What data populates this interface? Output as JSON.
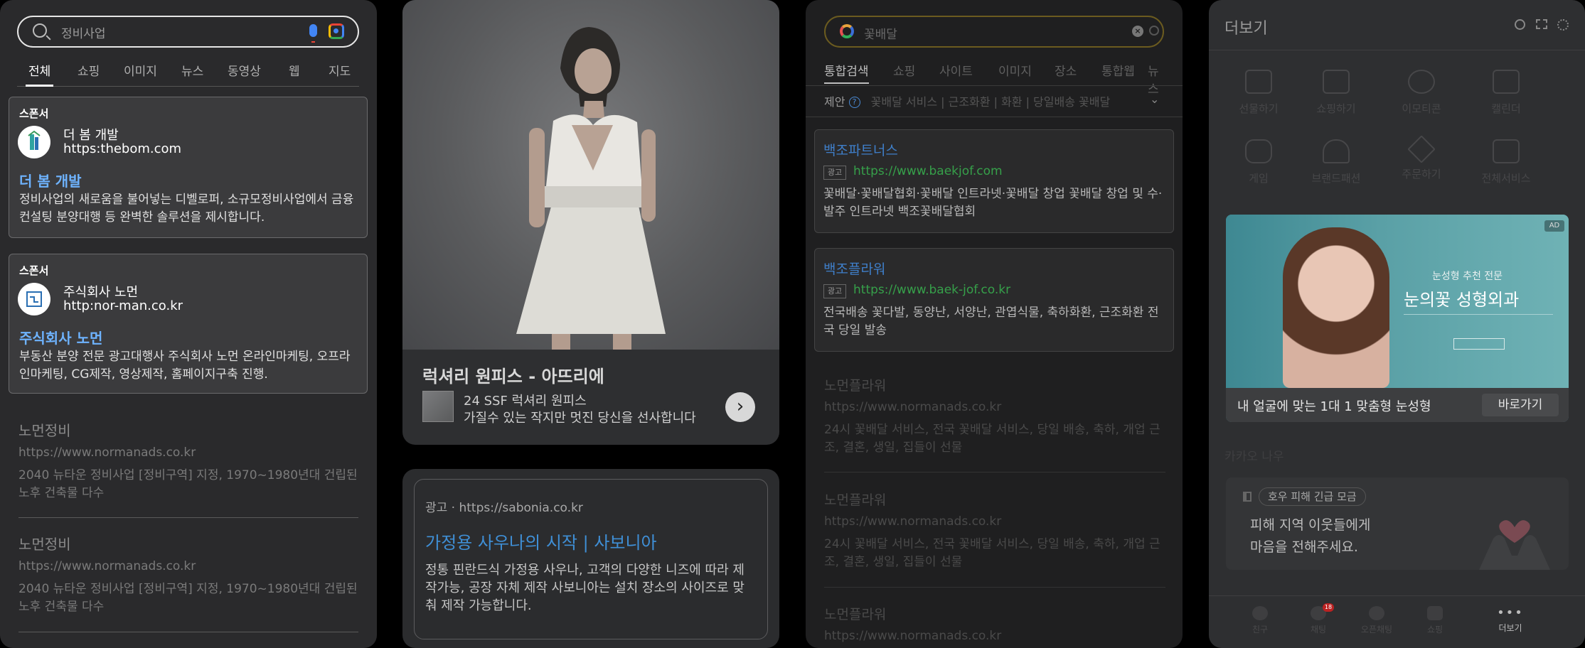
{
  "google": {
    "query": "정비사업",
    "tabs": [
      "전체",
      "쇼핑",
      "이미지",
      "뉴스",
      "동영상",
      "웹",
      "지도"
    ],
    "ads": [
      {
        "sponsor": "스폰서",
        "name": "더 봄 개발",
        "url": "https:thebom.com",
        "title": "더 봄 개발",
        "desc": "정비사업의 새로움을 불어넣는 디벨로퍼, 소규모정비사업에서 금융컨설팅 분양대행 등 완벽한 솔루션을 제시합니다."
      },
      {
        "sponsor": "스폰서",
        "name": "주식회사 노먼",
        "url": "http:nor-man.co.kr",
        "title": "주식회사 노먼",
        "desc": "부동산 분양 전문 광고대행사 주식회사 노먼 온라인마케팅, 오프라인마케팅, CG제작, 영상제작, 홈페이지구축 진행."
      }
    ],
    "results": [
      {
        "title": "노먼정비",
        "url": "https://www.normanads.co.kr",
        "desc": "2040 뉴타운 정비사업 [정비구역] 지정, 1970~1980년대 건립된 노후 건축물 다수"
      },
      {
        "title": "노먼정비",
        "url": "https://www.normanads.co.kr",
        "desc": "2040 뉴타운 정비사업 [정비구역] 지정, 1970~1980년대 건립된 노후 건축물 다수"
      }
    ]
  },
  "fashion_ad": {
    "title": "럭셔리 원피스 - 아뜨리에",
    "line1": "24 SSF 럭셔리 원피스",
    "line2": "가질수 있는 작지만 멋진 당신을 선사합니다",
    "arrow": "›"
  },
  "sauna_ad": {
    "meta": "광고 · https://sabonia.co.kr",
    "title": "가정용 사우나의 시작 | 사보니아",
    "desc": "정통 핀란드식 가정용 사우나, 고객의 다양한 니즈에 따라 제작가능, 공장 자체 제작 사보니아는 설치 장소의 사이즈로 맞춰 제작 가능합니다."
  },
  "daum": {
    "query": "꽃배달",
    "clear": "×",
    "tabs": [
      "통합검색",
      "쇼핑",
      "사이트",
      "이미지",
      "장소",
      "통합웹",
      "뉴스"
    ],
    "suggest_label": "제안",
    "suggest_q": "?",
    "suggestions": "꽃배달 서비스 | 근조화환 | 화환 | 당일배송 꽃배달",
    "ad_badge": "광고",
    "ads": [
      {
        "title": "백조파트너스",
        "url": "https://www.baekjof.com",
        "desc": "꽃배달·꽃배달협회·꽃배달 인트라넷·꽃배달 창업 꽃배달 창업 및 수·발주 인트라넷 백조꽃배달협회"
      },
      {
        "title": "백조플라워",
        "url": "https://www.baek-jof.co.kr",
        "desc": "전국배송 꽃다발, 동양난, 서양난, 관엽식물, 축하화환, 근조화환 전국 당일 발송"
      }
    ],
    "results": [
      {
        "title": "노먼플라워",
        "url": "https://www.normanads.co.kr",
        "desc": "24시 꽃배달 서비스, 전국 꽃배달 서비스, 당일 배송, 축하, 개업 근조, 결혼, 생일, 집들이 선물"
      },
      {
        "title": "노먼플라워",
        "url": "https://www.normanads.co.kr",
        "desc": "24시 꽃배달 서비스, 전국 꽃배달 서비스, 당일 배송, 축하, 개업 근조, 결혼, 생일, 집들이 선물"
      },
      {
        "title": "노먼플라워",
        "url": "https://www.normanads.co.kr",
        "desc": ""
      }
    ]
  },
  "kakao": {
    "title": "더보기",
    "grid": [
      "선물하기",
      "쇼핑하기",
      "이모티콘",
      "캘린더",
      "게임",
      "브랜드패션",
      "주문하기",
      "전체서비스"
    ],
    "banner": {
      "ad_mark": "AD",
      "tagline": "눈성형 추천 전문",
      "headline": "눈의꽃 성형외과",
      "bar_text": "내 얼굴에 맞는 1대 1 맞춤형 눈성형",
      "bar_button": "바로가기"
    },
    "section": "카카오 나우",
    "card": {
      "chip": "호우 피해 긴급 모금",
      "message_line1": "피해 지역 이웃들에게",
      "message_line2": "마음을 전해주세요."
    },
    "nav": [
      "친구",
      "채팅",
      "오픈채팅",
      "쇼핑",
      "더보기"
    ],
    "chat_badge": "18",
    "more_dots": "•••"
  }
}
